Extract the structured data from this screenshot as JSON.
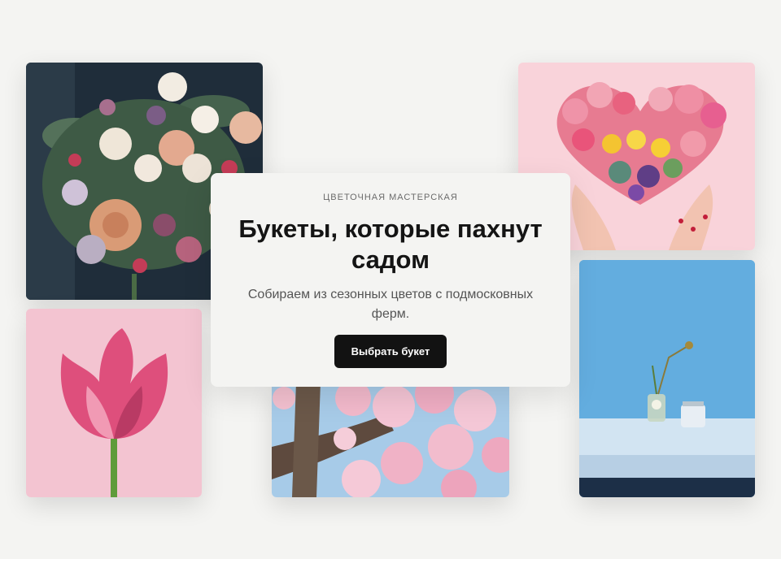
{
  "hero": {
    "eyebrow": "ЦВЕТОЧНАЯ МАСТЕРСКАЯ",
    "title": "Букеты, которые пахнут садом",
    "subtitle": "Собираем из сезонных цветов с подмосковных ферм.",
    "cta_label": "Выбрать букет"
  },
  "colors": {
    "background": "#f4f4f2",
    "button": "#121212",
    "button_text": "#ffffff",
    "title_text": "#141414"
  }
}
